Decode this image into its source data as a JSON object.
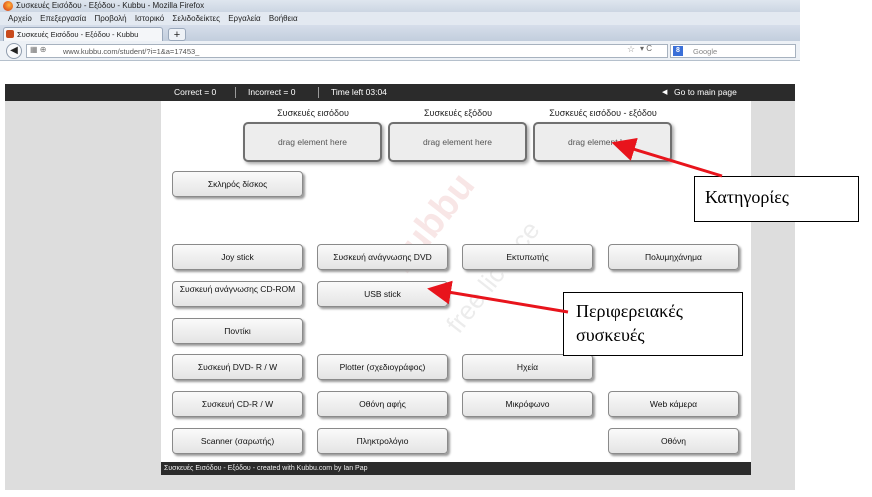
{
  "browser": {
    "window_title": "Συσκευές Εισόδου - Εξόδου - Kubbu - Mozilla Firefox",
    "menu": [
      "Αρχείο",
      "Επεξεργασία",
      "Προβολή",
      "Ιστορικό",
      "Σελιδοδείκτες",
      "Εργαλεία",
      "Βοήθεια"
    ],
    "tab_title": "Συσκευές Εισόδου - Εξόδου - Kubbu",
    "new_tab": "+",
    "url": "www.kubbu.com/student/?i=1&a=17453_",
    "search_placeholder": "Google",
    "back_glyph": "◀",
    "star_glyph": "☆",
    "nav_glyphs": "▾ C",
    "search_engine_glyph": "8"
  },
  "status": {
    "correct": "Correct = 0",
    "incorrect": "Incorrect = 0",
    "time_left": "Time left 03:04",
    "main_page": "Go to main page",
    "main_page_glyph": "◀"
  },
  "categories": [
    {
      "label": "Συσκευές εισόδου",
      "drop_text": "drag element here"
    },
    {
      "label": "Συσκευές εξόδου",
      "drop_text": "drag element here"
    },
    {
      "label": "Συσκευές εισόδου - εξόδου",
      "drop_text": "drag element here"
    }
  ],
  "elements": [
    "Σκληρός δίσκος",
    "Joy stick",
    "Συσκευή ανάγνωσης DVD",
    "Εκτυπωτής",
    "Πολυμηχάνημα",
    "Συσκευή ανάγνωσης CD-ROM",
    "USB stick",
    "Ποντίκι",
    "Συσκευή DVD- R / W",
    "Plotter (σχεδιογράφος)",
    "Ηχεία",
    "Συσκευή CD-R / W",
    "Οθόνη αφής",
    "Μικρόφωνο",
    "Web κάμερα",
    "Scanner (σαρωτής)",
    "Πληκτρολόγιο",
    "Οθόνη"
  ],
  "watermark": "kubbu",
  "watermark2": "free licence",
  "footer": "Συσκευές Εισόδου - Εξόδου - created with Kubbu.com by Ian Pap",
  "annotations": {
    "categories_label": "Κατηγορίες",
    "devices_label": "Περιφερειακές συσκευές"
  },
  "colors": {
    "arrow": "#e8141c",
    "status_bar": "#2b2b2b"
  }
}
